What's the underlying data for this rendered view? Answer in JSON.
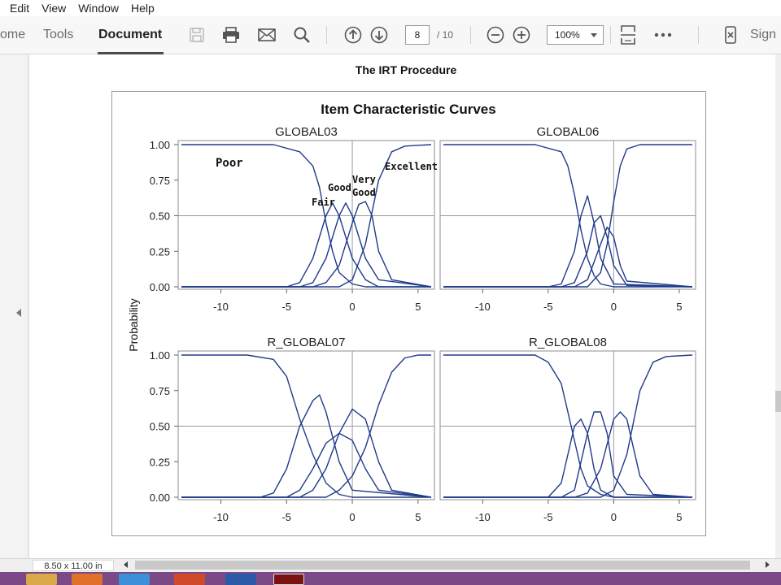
{
  "menu": [
    "Edit",
    "View",
    "Window",
    "Help"
  ],
  "toolbar": {
    "tabs": [
      "ome",
      "Tools",
      "Document"
    ],
    "current_page": "8",
    "total_pages": "/ 10",
    "zoom": "100%",
    "sign_label": "Sign",
    "icons": [
      "save-icon",
      "print-icon",
      "email-icon",
      "search-icon",
      "page-up-icon",
      "page-down-icon",
      "zoom-out-icon",
      "zoom-in-icon",
      "fit-page-icon",
      "more-icon",
      "mobile-icon"
    ]
  },
  "document": {
    "heading": "The IRT Procedure",
    "page_size": "8.50 x 11.00 in"
  },
  "colors": {
    "curve": "#1f3a8a",
    "toolbar_bg": "#f7f7f7",
    "taskbar": "#7b4a86"
  },
  "chart_data": {
    "type": "line",
    "title": "Item Characteristic Curves",
    "ylabel": "Probability",
    "xlim": [
      -13,
      6
    ],
    "ylim": [
      0,
      1
    ],
    "x_ticks": [
      -10,
      -5,
      0,
      5
    ],
    "y_ticks": [
      "0.00",
      "0.25",
      "0.50",
      "0.75",
      "1.00"
    ],
    "grid": "reference lines at x=0 and y=0.5",
    "panels": [
      {
        "name": "GLOBAL03",
        "category_labels": [
          "Poor",
          "Fair",
          "Good",
          "Very",
          "Good",
          "Excellent"
        ],
        "series": [
          {
            "x": [
              -13,
              -6,
              -4,
              -3,
              -2.5,
              -2,
              -1.5,
              -1,
              0,
              1,
              2,
              6
            ],
            "y": [
              1,
              1,
              0.95,
              0.85,
              0.7,
              0.45,
              0.25,
              0.1,
              0.02,
              0,
              0,
              0
            ]
          },
          {
            "x": [
              -13,
              -5,
              -4,
              -3,
              -2,
              -1.5,
              -1,
              0,
              1,
              2,
              6
            ],
            "y": [
              0,
              0,
              0.03,
              0.2,
              0.5,
              0.59,
              0.5,
              0.2,
              0.05,
              0,
              0
            ]
          },
          {
            "x": [
              -13,
              -4,
              -3,
              -2,
              -1,
              -0.5,
              0,
              1,
              2,
              6
            ],
            "y": [
              0,
              0,
              0.03,
              0.2,
              0.5,
              0.59,
              0.5,
              0.2,
              0.05,
              0
            ]
          },
          {
            "x": [
              -13,
              -3,
              -2,
              -1,
              0,
              0.5,
              1,
              1.5,
              2,
              3,
              6
            ],
            "y": [
              0,
              0,
              0.03,
              0.15,
              0.45,
              0.58,
              0.6,
              0.5,
              0.25,
              0.05,
              0
            ]
          },
          {
            "x": [
              -13,
              -1,
              0,
              1,
              2,
              3,
              4,
              6
            ],
            "y": [
              0,
              0,
              0.05,
              0.3,
              0.75,
              0.95,
              0.99,
              1
            ]
          }
        ]
      },
      {
        "name": "GLOBAL06",
        "series": [
          {
            "x": [
              -13,
              -6,
              -4,
              -3.5,
              -3,
              -2.5,
              -2,
              -1.5,
              -1,
              0,
              6
            ],
            "y": [
              1,
              1,
              0.95,
              0.85,
              0.65,
              0.4,
              0.2,
              0.08,
              0.02,
              0,
              0
            ]
          },
          {
            "x": [
              -13,
              -5,
              -4,
              -3,
              -2.5,
              -2,
              -1.5,
              -1,
              0,
              6
            ],
            "y": [
              0,
              0,
              0.02,
              0.25,
              0.5,
              0.64,
              0.45,
              0.2,
              0.02,
              0
            ]
          },
          {
            "x": [
              -13,
              -4,
              -3,
              -2,
              -1.5,
              -1,
              -0.5,
              0,
              1,
              6
            ],
            "y": [
              0,
              0,
              0.03,
              0.25,
              0.45,
              0.5,
              0.35,
              0.15,
              0.01,
              0
            ]
          },
          {
            "x": [
              -13,
              -3,
              -2,
              -1,
              -0.5,
              0,
              0.5,
              1,
              6
            ],
            "y": [
              0,
              0,
              0.05,
              0.3,
              0.42,
              0.35,
              0.15,
              0.04,
              0
            ]
          },
          {
            "x": [
              -13,
              -2,
              -1,
              -0.5,
              0,
              0.5,
              1,
              2,
              6
            ],
            "y": [
              0,
              0,
              0.1,
              0.3,
              0.6,
              0.85,
              0.97,
              1,
              1
            ]
          }
        ]
      },
      {
        "name": "R_GLOBAL07",
        "series": [
          {
            "x": [
              -13,
              -8,
              -6,
              -5,
              -4,
              -3,
              -2,
              -1,
              0,
              6
            ],
            "y": [
              1,
              1,
              0.97,
              0.85,
              0.55,
              0.3,
              0.1,
              0.02,
              0,
              0
            ]
          },
          {
            "x": [
              -13,
              -7,
              -6,
              -5,
              -4,
              -3,
              -2.5,
              -2,
              -1,
              0,
              6
            ],
            "y": [
              0,
              0,
              0.03,
              0.2,
              0.5,
              0.68,
              0.72,
              0.6,
              0.25,
              0.05,
              0
            ]
          },
          {
            "x": [
              -13,
              -5,
              -4,
              -3,
              -2,
              -1,
              0,
              1,
              2,
              6
            ],
            "y": [
              0,
              0,
              0.05,
              0.2,
              0.38,
              0.45,
              0.4,
              0.2,
              0.05,
              0
            ]
          },
          {
            "x": [
              -13,
              -4,
              -3,
              -2,
              -1,
              0,
              1,
              2,
              3,
              6
            ],
            "y": [
              0,
              0,
              0.05,
              0.2,
              0.45,
              0.62,
              0.55,
              0.25,
              0.05,
              0
            ]
          },
          {
            "x": [
              -13,
              -2,
              -1,
              0,
              1,
              2,
              3,
              4,
              5,
              6
            ],
            "y": [
              0,
              0,
              0.05,
              0.15,
              0.35,
              0.65,
              0.88,
              0.98,
              1,
              1
            ]
          }
        ]
      },
      {
        "name": "R_GLOBAL08",
        "series": [
          {
            "x": [
              -13,
              -6,
              -5,
              -4,
              -3.5,
              -3,
              -2.5,
              -2,
              -1,
              0,
              6
            ],
            "y": [
              1,
              1,
              0.95,
              0.8,
              0.6,
              0.4,
              0.2,
              0.08,
              0.02,
              0,
              0
            ]
          },
          {
            "x": [
              -13,
              -5,
              -4,
              -3,
              -2.5,
              -2,
              -1.5,
              -1,
              0,
              6
            ],
            "y": [
              0,
              0,
              0.1,
              0.5,
              0.55,
              0.45,
              0.2,
              0.05,
              0,
              0
            ]
          },
          {
            "x": [
              -13,
              -4,
              -3,
              -2,
              -1.5,
              -1,
              -0.5,
              0,
              1,
              6
            ],
            "y": [
              0,
              0,
              0.05,
              0.45,
              0.6,
              0.6,
              0.45,
              0.15,
              0.02,
              0
            ]
          },
          {
            "x": [
              -13,
              -3,
              -2,
              -1,
              0,
              0.5,
              1,
              1.5,
              2,
              3,
              6
            ],
            "y": [
              0,
              0,
              0.03,
              0.2,
              0.55,
              0.6,
              0.55,
              0.35,
              0.15,
              0.02,
              0
            ]
          },
          {
            "x": [
              -13,
              -1,
              0,
              1,
              2,
              3,
              4,
              6
            ],
            "y": [
              0,
              0,
              0.05,
              0.3,
              0.75,
              0.95,
              0.99,
              1
            ]
          }
        ]
      }
    ]
  }
}
